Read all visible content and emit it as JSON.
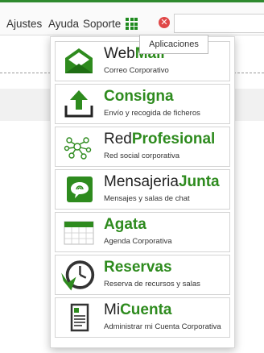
{
  "menu": {
    "ajustes": "Ajustes",
    "ayuda": "Ayuda",
    "soporte": "Soporte"
  },
  "tooltip": "Aplicaciones",
  "apps": [
    {
      "title_a": "Web",
      "title_b": "Mail",
      "subtitle": "Correo Corporativo",
      "icon": "webmail-envelope-icon"
    },
    {
      "title_a": "",
      "title_b": "Consigna",
      "subtitle": "Envío y recogida de ficheros",
      "icon": "upload-arrow-icon"
    },
    {
      "title_a": "Red",
      "title_b": "Profesional",
      "subtitle": "Red social corporativa",
      "icon": "network-nodes-icon"
    },
    {
      "title_a": "Mensajeria",
      "title_b": "Junta",
      "subtitle": "Mensajes y salas de chat",
      "icon": "chat-bubble-icon"
    },
    {
      "title_a": "",
      "title_b": "Agata",
      "subtitle": "Agenda Corporativa",
      "icon": "calendar-icon"
    },
    {
      "title_a": "",
      "title_b": "Reservas",
      "subtitle": "Reserva de recursos y salas",
      "icon": "clock-reservation-icon"
    },
    {
      "title_a": "Mi",
      "title_b": "Cuenta",
      "subtitle": "Administrar mi Cuenta Corporativa",
      "icon": "account-form-icon"
    }
  ],
  "colors": {
    "brand_green": "#2e8b1e",
    "error_red": "#e04848"
  }
}
